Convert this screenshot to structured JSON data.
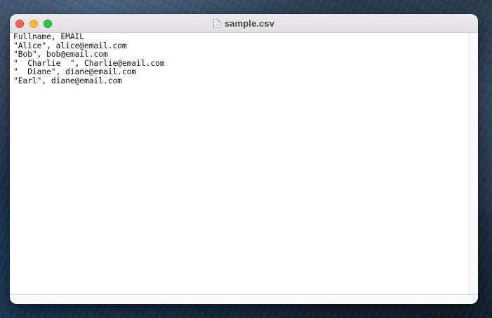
{
  "window": {
    "title": "sample.csv",
    "file_icon": "document-icon"
  },
  "editor": {
    "lines": [
      "Fullname, EMAIL",
      "\"Alice\", alice@email.com",
      "\"Bob\", bob@email.com",
      "\"  Charlie  \", Charlie@email.com",
      "\"  Diane\", diane@email.com",
      "\"Earl\", diane@email.com"
    ]
  },
  "colors": {
    "close": "#fe5f57",
    "minimize": "#febc2e",
    "maximize": "#28c840"
  }
}
